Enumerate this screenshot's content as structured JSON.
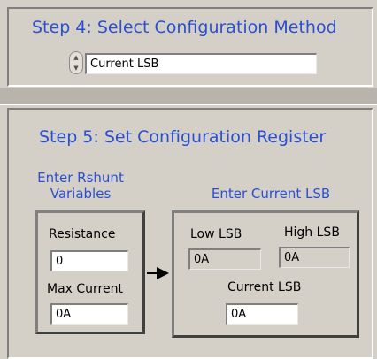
{
  "step4": {
    "title": "Step 4: Select Configuration Method",
    "method_value": "Current LSB"
  },
  "step5": {
    "title": "Step 5: Set Configuration Register",
    "rshunt": {
      "heading": "Enter Rshunt Variables",
      "resistance_label": "Resistance",
      "resistance_value": "0",
      "max_current_label": "Max Current",
      "max_current_value": "0A"
    },
    "current_lsb": {
      "heading": "Enter Current LSB",
      "low_lsb_label": "Low LSB",
      "low_lsb_value": "0A",
      "high_lsb_label": "High LSB",
      "high_lsb_value": "0A",
      "current_lsb_label": "Current LSB",
      "current_lsb_value": "0A"
    }
  },
  "icons": {
    "method_spinner": "up-down-spinner-icon",
    "flow_arrow": "right-arrow-icon"
  }
}
